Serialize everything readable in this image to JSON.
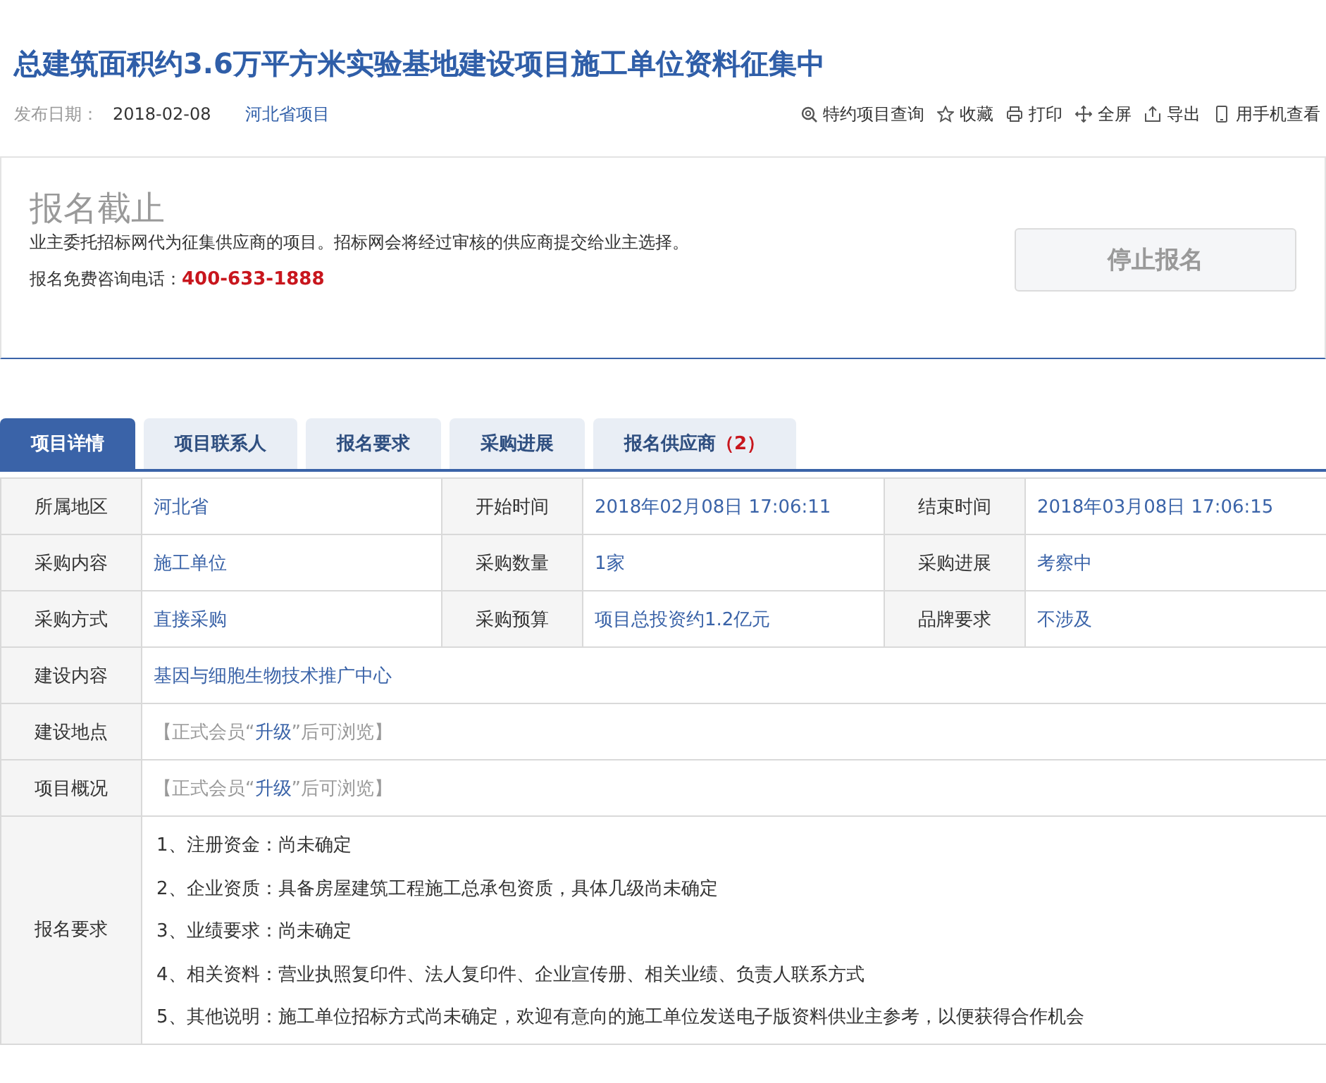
{
  "title": "总建筑面积约3.6万平方米实验基地建设项目施工单位资料征集中",
  "meta": {
    "date_label": "发布日期：",
    "date": "2018-02-08",
    "region_link": "河北省项目"
  },
  "actions": [
    {
      "kind": "search",
      "label": "特约项目查询"
    },
    {
      "kind": "star",
      "label": "收藏"
    },
    {
      "kind": "print",
      "label": "打印"
    },
    {
      "kind": "fullscreen",
      "label": "全屏"
    },
    {
      "kind": "export",
      "label": "导出"
    },
    {
      "kind": "phone",
      "label": "用手机查看"
    }
  ],
  "notice": {
    "status": "报名截止",
    "description": "业主委托招标网代为征集供应商的项目。招标网会将经过审核的供应商提交给业主选择。",
    "hotline_label": "报名免费咨询电话：",
    "hotline": "400-633-1888",
    "button": {
      "label": "停止报名",
      "disabled": true
    }
  },
  "tabs": [
    {
      "label": "项目详情",
      "selected": true
    },
    {
      "label": "项目联系人",
      "selected": false
    },
    {
      "label": "报名要求",
      "selected": false
    },
    {
      "label": "采购进展",
      "selected": false
    },
    {
      "label": "报名供应商",
      "count": "（2）",
      "selected": false
    }
  ],
  "table": {
    "rows": [
      {
        "kind": "triple",
        "cells": [
          {
            "label": "所属地区",
            "value": "河北省"
          },
          {
            "label": "开始时间",
            "value": "2018年02月08日 17:06:11"
          },
          {
            "label": "结束时间",
            "value": "2018年03月08日 17:06:15"
          }
        ]
      },
      {
        "kind": "triple",
        "cells": [
          {
            "label": "采购内容",
            "value": "施工单位"
          },
          {
            "label": "采购数量",
            "value": "1家"
          },
          {
            "label": "采购进展",
            "value": "考察中"
          }
        ]
      },
      {
        "kind": "triple",
        "cells": [
          {
            "label": "采购方式",
            "value": "直接采购"
          },
          {
            "label": "采购预算",
            "value": "项目总投资约1.2亿元"
          },
          {
            "label": "品牌要求",
            "value": "不涉及"
          }
        ]
      },
      {
        "kind": "single",
        "label": "建设内容",
        "value": "基因与细胞生物技术推广中心"
      },
      {
        "kind": "locked",
        "label": "建设地点",
        "prefix": "【正式会员“",
        "link": "升级",
        "suffix": "”后可浏览】"
      },
      {
        "kind": "locked",
        "label": "项目概况",
        "prefix": "【正式会员“",
        "link": "升级",
        "suffix": "”后可浏览】"
      },
      {
        "kind": "list",
        "label": "报名要求",
        "items": [
          "1、注册资金：尚未确定",
          "2、企业资质：具备房屋建筑工程施工总承包资质，具体几级尚未确定",
          "3、业绩要求：尚未确定",
          "4、相关资料：营业执照复印件、法人复印件、企业宣传册、相关业绩、负责人联系方式",
          "5、其他说明：施工单位招标方式尚未确定，欢迎有意向的施工单位发送电子版资料供业主参考，以便获得合作机会"
        ]
      }
    ]
  }
}
